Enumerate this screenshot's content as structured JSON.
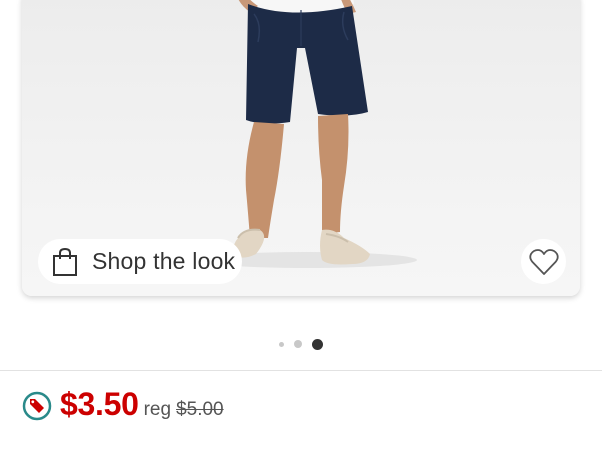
{
  "product_image": {
    "shop_the_look_label": "Shop the look",
    "bag_icon": "shopping-bag-icon",
    "favorite_icon": "heart-outline-icon"
  },
  "carousel": {
    "total": 3,
    "active_index": 3
  },
  "pricing": {
    "sale_price": "$3.50",
    "reg_label": "reg",
    "reg_price": "$5.00",
    "deal_icon": "sale-tag-icon",
    "sale_color": "#cc0000",
    "deal_ring_color": "#2a8a8a"
  }
}
